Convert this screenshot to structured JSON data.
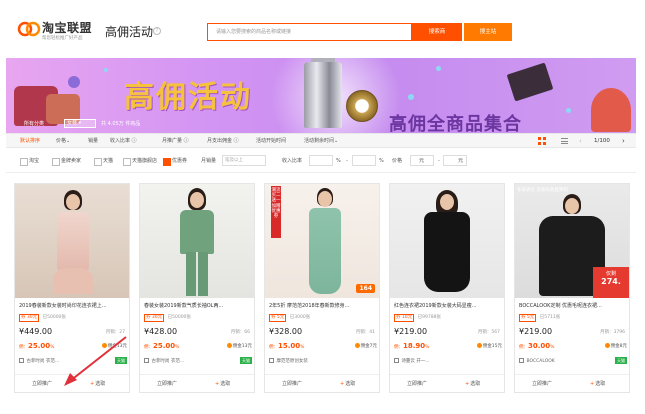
{
  "header": {
    "brand": "淘宝联盟",
    "brand_sub": "帮您轻松推广好产品",
    "site_title": "高佣活动",
    "search_placeholder": "请输入您要搜索的商品名称或链接",
    "search_button": "搜索商",
    "promo_button": "搜主站"
  },
  "banner": {
    "title": "高佣活动",
    "subtitle": "高佣全商品集合"
  },
  "breadcrumb": {
    "label": "所有分类",
    "selected": "女装",
    "result": "共 4.05万 件商品"
  },
  "sortbar": {
    "items": [
      "默认排序",
      "价格",
      "销量",
      "收入比率",
      "月推广量",
      "月支出佣金",
      "活动开始时间",
      "活动剩余时间"
    ],
    "active_index": 0,
    "pager": "1/100"
  },
  "filters": {
    "checkboxes": [
      {
        "label": "淘宝",
        "checked": false
      },
      {
        "label": "金牌卖家",
        "checked": false
      },
      {
        "label": "天猫",
        "checked": false
      },
      {
        "label": "天猫旗舰店",
        "checked": false
      },
      {
        "label": "优惠券",
        "checked": true
      }
    ],
    "monthly_sales_label": "月销量",
    "monthly_sales_placeholder": "笔及以上",
    "income_ratio_label": "收入比率",
    "percent": "%",
    "dash": "-",
    "price_label": "价格",
    "yuan": "元"
  },
  "products": [
    {
      "title": "2019春装新款女装时尚印花连衣裙上...",
      "coupon": "券 30元",
      "coupon_sales": "已50000张",
      "price": "¥449.00",
      "sold": "月销：27",
      "rate_label": "佣：",
      "rate": "25.00",
      "rate_unit": "%",
      "commission": "佣金13元",
      "shop": "古菲时尚 衣范...",
      "tmall": "天猫",
      "promote": "立即推广",
      "select": "选取"
    },
    {
      "title": "春装女装2019新款气质长袖OL两...",
      "coupon": "券 30元",
      "coupon_sales": "已50000张",
      "price": "¥428.00",
      "sold": "月销：66",
      "rate_label": "佣：",
      "rate": "25.00",
      "rate_unit": "%",
      "commission": "佣金13元",
      "shop": "古菲时尚 衣范...",
      "tmall": "天猫",
      "promote": "立即推广",
      "select": "选取"
    },
    {
      "title": "2年5折 摩范范2018年春新款修身...",
      "coupon": "券 5元",
      "coupon_sales": "已3000张",
      "price": "¥328.00",
      "sold": "月销：41",
      "rate_label": "佣：",
      "rate": "15.00",
      "rate_unit": "%",
      "commission": "佣金7元",
      "shop": "摩范范原创女装",
      "tmall": "",
      "promote": "立即推广",
      "select": "选取",
      "side_badge": "潮流买二送一加赠优惠券",
      "corner": "164"
    },
    {
      "title": "红色连衣裙2019新款女装大码显瘦...",
      "coupon": "券 10元",
      "coupon_sales": "已99788张",
      "price": "¥219.00",
      "sold": "月销：567",
      "rate_label": "佣：",
      "rate": "18.90",
      "rate_unit": "%",
      "commission": "佣金15元",
      "shop": "诗蔓云 开一...",
      "tmall": "",
      "promote": "立即推广",
      "select": "选取"
    },
    {
      "title": "BOCCALOOK定制 优惠毛呢连衣裙...",
      "coupon": "券 5元",
      "coupon_sales": "已5711张",
      "price": "¥219.00",
      "sold": "月销：3796",
      "rate_label": "佣：",
      "rate": "30.00",
      "rate_unit": "%",
      "commission": "佣金8元",
      "shop": "BOCCALOOK",
      "tmall": "天猫",
      "promote": "立即推广",
      "select": "选取",
      "overlay": "冬末清仓 实格长款直降到",
      "red_corner_top": "仅剩",
      "red_corner_price": "274."
    }
  ],
  "colors": {
    "accent": "#ff5000",
    "accent2": "#ff7a00",
    "banner_gold": "#f6c23e",
    "tmall_green": "#2bb14a",
    "annotation_red": "#e0303a"
  }
}
